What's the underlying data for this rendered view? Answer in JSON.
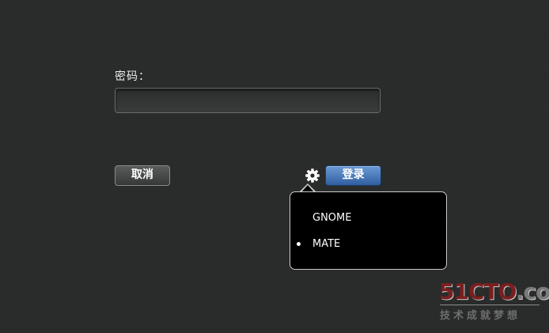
{
  "login": {
    "password_label": "密码：",
    "password_value": "",
    "cancel_label": "取消",
    "login_label": "登录"
  },
  "session_menu": {
    "items": [
      {
        "label": "GNOME",
        "selected": false
      },
      {
        "label": "MATE",
        "selected": true
      }
    ]
  },
  "watermark": {
    "logo": "51CTO",
    "logo_suffix": ".com",
    "tagline": "技术成就梦想"
  },
  "icons": {
    "session_button": "gear-icon",
    "selected_marker": "bullet-icon"
  },
  "colors": {
    "background": "#2a2b2b",
    "login_button": "#3f6fb0",
    "popup_background": "#000000"
  }
}
